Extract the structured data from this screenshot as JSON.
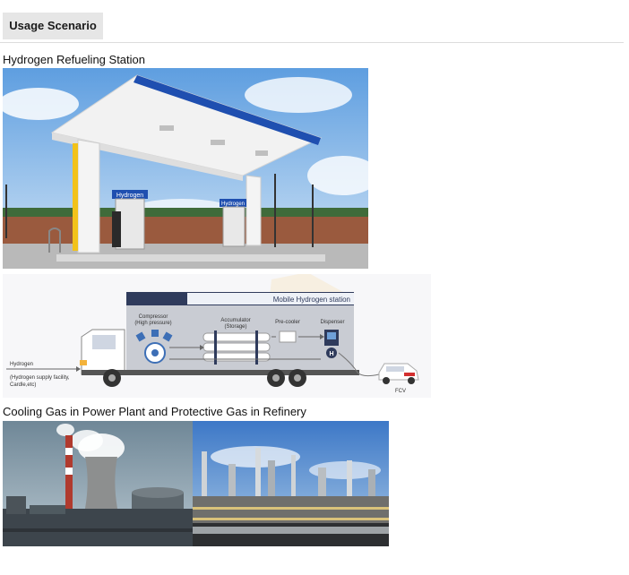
{
  "tab": {
    "label": "Usage Scenario"
  },
  "sections": [
    {
      "heading": "Hydrogen Refueling Station"
    },
    {
      "heading": "Cooling Gas in Power Plant and Protective Gas in Refinery"
    }
  ],
  "station_image": {
    "sign_text": "Hydrogen",
    "sign_text_2": "Hydrogen"
  },
  "truck_diagram": {
    "title": "Mobile Hydrogen station",
    "compressor": "Compressor",
    "compressor_sub": "(High pressure)",
    "accumulator": "Accumulator",
    "accumulator_sub": "(Storage)",
    "precooler": "Pre-cooler",
    "dispenser": "Dispenser",
    "hydrogen_label": "Hydrogen",
    "supply_line1": "(Hydrogen supply facility,",
    "supply_line2": "Cardle,etc)",
    "fcv_label": "FCV",
    "h_badge": "H"
  },
  "colors": {
    "canopy_blue": "#1f4fb0",
    "sky": "#7fb3e6",
    "truck_navy": "#2f3b5c",
    "accent_orange": "#f3b23a"
  }
}
